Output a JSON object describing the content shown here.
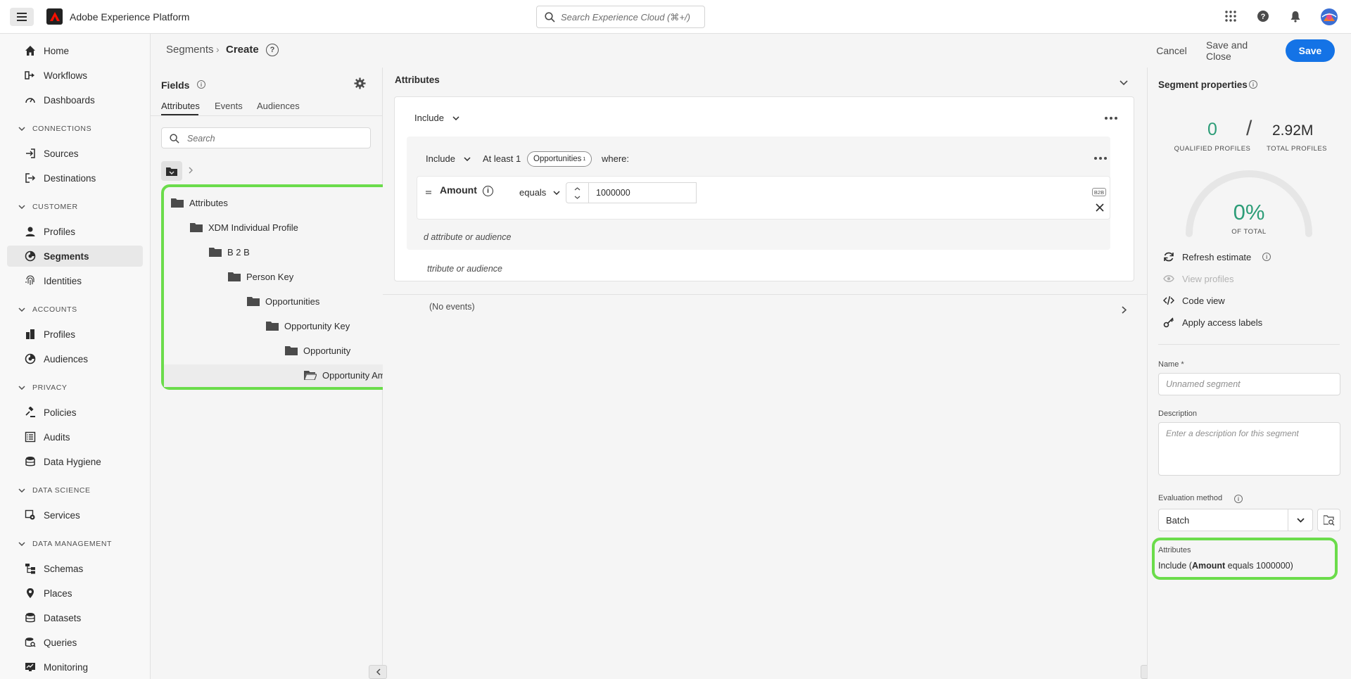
{
  "topbar": {
    "app_title": "Adobe Experience Platform",
    "search_placeholder": "Search Experience Cloud (⌘+/)"
  },
  "nav": {
    "home": "Home",
    "workflows": "Workflows",
    "dashboards": "Dashboards",
    "sec_connections": "CONNECTIONS",
    "sources": "Sources",
    "destinations": "Destinations",
    "sec_customer": "CUSTOMER",
    "profiles": "Profiles",
    "segments": "Segments",
    "identities": "Identities",
    "sec_accounts": "ACCOUNTS",
    "acc_profiles": "Profiles",
    "audiences": "Audiences",
    "sec_privacy": "PRIVACY",
    "policies": "Policies",
    "audits": "Audits",
    "data_hygiene": "Data Hygiene",
    "sec_data_science": "DATA SCIENCE",
    "services": "Services",
    "sec_data_management": "DATA MANAGEMENT",
    "schemas": "Schemas",
    "places": "Places",
    "datasets": "Datasets",
    "queries": "Queries",
    "monitoring": "Monitoring"
  },
  "header": {
    "breadcrumb_parent": "Segments",
    "breadcrumb_sep": "›",
    "breadcrumb_current": "Create",
    "help": "?",
    "cancel": "Cancel",
    "save_close": "Save and Close",
    "save": "Save"
  },
  "fields": {
    "title": "Fields",
    "tabs": [
      "Attributes",
      "Events",
      "Audiences"
    ],
    "search_placeholder": "Search",
    "tree": [
      "Attributes",
      "XDM Individual Profile",
      "B 2 B",
      "Person Key",
      "Opportunities",
      "Opportunity Key",
      "Opportunity",
      "Opportunity Amount"
    ]
  },
  "canvas": {
    "section_title": "Attributes",
    "include_outer": "Include",
    "include_inner": "Include",
    "at_least": "At least 1",
    "pill_label": "Opportunities",
    "pill_sup": "1",
    "where": "where:",
    "field_name": "Amount",
    "operator": "equals",
    "value": "1000000",
    "badge": "B2B",
    "hint_inner": "d attribute or audience",
    "hint_outer": "ttribute or audience",
    "no_events": "(No events)"
  },
  "props": {
    "title": "Segment properties",
    "qualified_count": "0",
    "qualified_label": "QUALIFIED PROFILES",
    "slash": "/",
    "total_count": "2.92M",
    "total_label": "TOTAL PROFILES",
    "percent": "0%",
    "percent_label": "OF TOTAL",
    "qualified_fraction": 0,
    "refresh": "Refresh estimate",
    "view_profiles": "View profiles",
    "code_view": "Code view",
    "apply_labels": "Apply access labels",
    "name_label": "Name *",
    "name_placeholder": "Unnamed segment",
    "desc_label": "Description",
    "desc_placeholder": "Enter a description for this segment",
    "eval_label": "Evaluation method",
    "eval_value": "Batch",
    "summary_title": "Attributes",
    "summary_prefix": "Include (",
    "summary_field": "Amount",
    "summary_suffix": " equals 1000000)"
  },
  "colors": {
    "accent": "#1473e6",
    "highlight": "#6bdc4b",
    "positive": "#2d9d78"
  }
}
